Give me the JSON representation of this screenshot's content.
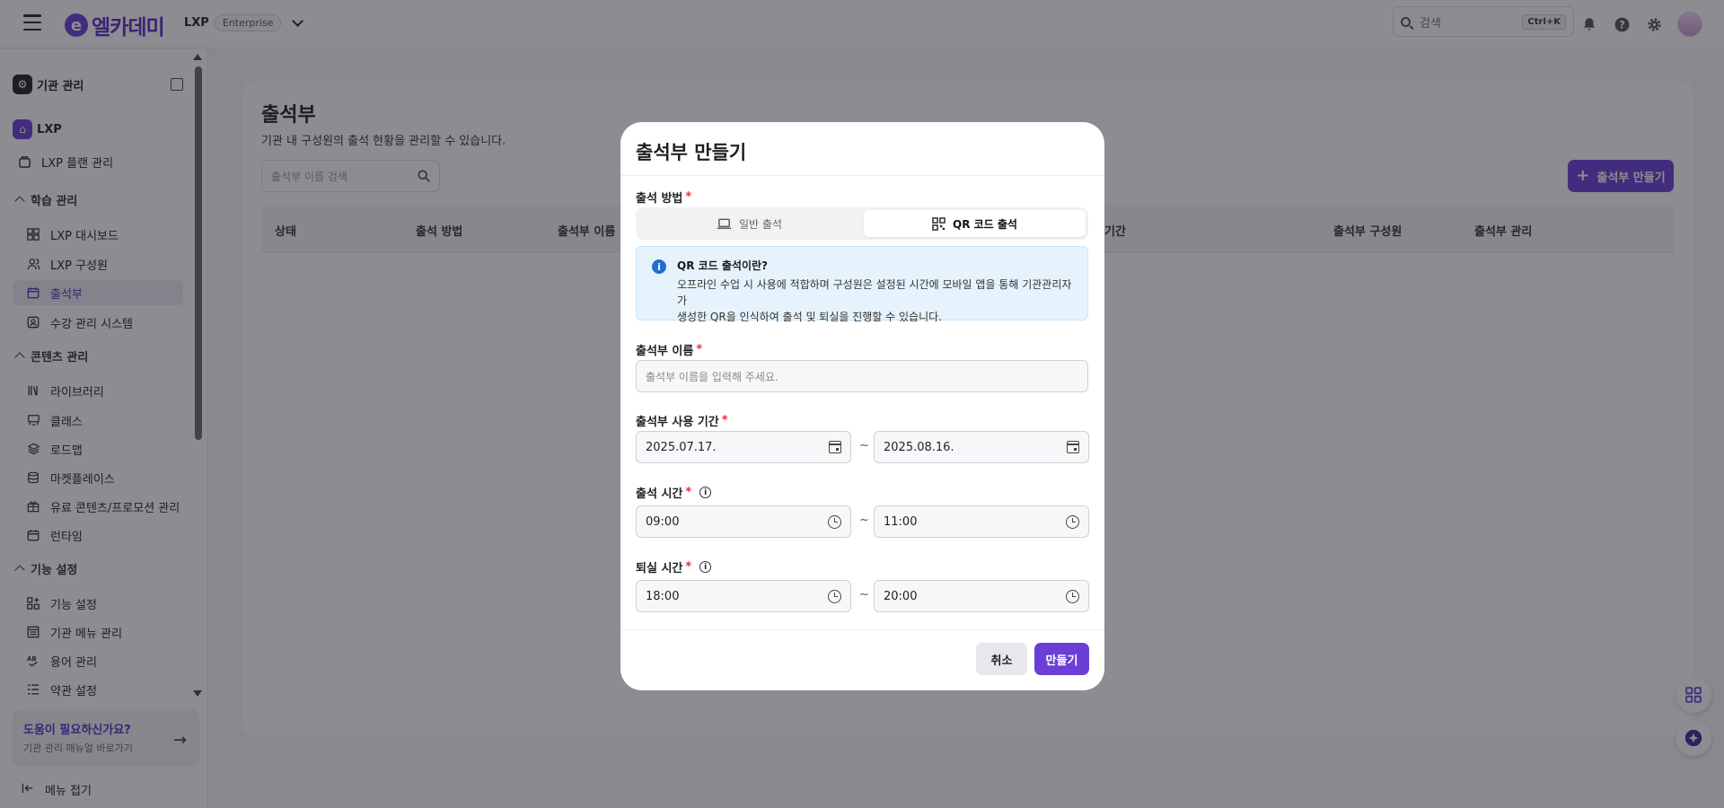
{
  "header": {
    "brand": "엘카데미",
    "logo_letter": "e",
    "product": "LXP",
    "badge": "Enterprise",
    "search_placeholder": "검색",
    "search_shortcut": "Ctrl+K"
  },
  "sidebar": {
    "org_admin": "기관 관리",
    "lxp": "LXP",
    "plan": "LXP 플랜 관리",
    "sections": {
      "learning": "학습 관리",
      "content": "콘텐츠 관리",
      "features": "기능 설정"
    },
    "learning_items": [
      "LXP 대시보드",
      "LXP 구성원",
      "출석부",
      "수강 관리 시스템"
    ],
    "content_items": [
      "라이브러리",
      "클래스",
      "로드맵",
      "마켓플레이스",
      "유료 콘텐츠/프로모션 관리",
      "런타임"
    ],
    "feature_items": [
      "기능 설정",
      "기관 메뉴 관리",
      "용어 관리",
      "약관 설정"
    ],
    "help_title": "도움이 필요하신가요?",
    "help_sub": "기관 관리 매뉴얼 바로가기",
    "collapse": "메뉴 접기"
  },
  "page": {
    "title": "출석부",
    "subtitle": "기관 내 구성원의 출석 현황을 관리할 수 있습니다.",
    "search_placeholder": "출석부 이름 검색",
    "create_button": "출석부 만들기",
    "columns": [
      "상태",
      "출석 방법",
      "출석부 이름",
      "기간",
      "출석부 구성원",
      "출석부 관리"
    ]
  },
  "modal": {
    "title": "출석부 만들기",
    "method_label": "출석 방법",
    "required_mark": "*",
    "method_options": [
      "일반 출석",
      "QR 코드 출석"
    ],
    "selected_method": "QR 코드 출석",
    "notice_title": "QR 코드 출석이란?",
    "notice_line1": "오프라인 수업 시 사용에 적합하며 구성원은 설정된 시간에 모바일 앱을 통해 기관관리자가",
    "notice_line2": "생성한 QR을 인식하여 출석 및 퇴실을 진행할 수 있습니다.",
    "name_label": "출석부 이름",
    "name_placeholder": "출석부 이름을 입력해 주세요.",
    "period_label": "출석부 사용 기간",
    "period_start": "2025.07.17.",
    "period_end": "2025.08.16.",
    "attend_label": "출석 시간",
    "attend_start": "09:00",
    "attend_end": "11:00",
    "leave_label": "퇴실 시간",
    "leave_start": "18:00",
    "leave_end": "20:00",
    "range_sep": "~",
    "cancel": "취소",
    "create": "만들기"
  },
  "colors": {
    "primary": "#6b3fd6",
    "notice_bg": "#e6f3fd",
    "required": "#e0323c"
  }
}
